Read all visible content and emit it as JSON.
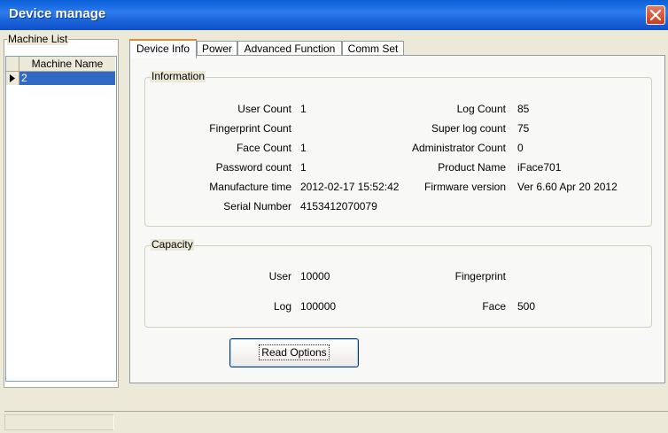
{
  "window": {
    "title": "Device manage"
  },
  "machine_list": {
    "title": "Machine List",
    "column_header": "Machine Name",
    "rows": [
      "2"
    ]
  },
  "tabs": [
    "Device Info",
    "Power",
    "Advanced Function",
    "Comm Set"
  ],
  "information": {
    "title": "Information",
    "left": [
      {
        "label": "User Count",
        "value": "1"
      },
      {
        "label": "Fingerprint Count",
        "value": ""
      },
      {
        "label": "Face Count",
        "value": "1"
      },
      {
        "label": "Password count",
        "value": "1"
      },
      {
        "label": "Manufacture time",
        "value": "2012-02-17 15:52:42"
      },
      {
        "label": "Serial Number",
        "value": "4153412070079"
      }
    ],
    "right": [
      {
        "label": "Log Count",
        "value": "85"
      },
      {
        "label": "Super log count",
        "value": "75"
      },
      {
        "label": "Administrator Count",
        "value": "0"
      },
      {
        "label": "Product Name",
        "value": "iFace701"
      },
      {
        "label": "Firmware version",
        "value": "Ver 6.60 Apr 20 2012"
      }
    ]
  },
  "capacity": {
    "title": "Capacity",
    "left": [
      {
        "label": "User",
        "value": "10000"
      },
      {
        "label": "Log",
        "value": "100000"
      }
    ],
    "right": [
      {
        "label": "Fingerprint",
        "value": ""
      },
      {
        "label": "Face",
        "value": "500"
      }
    ]
  },
  "read_button": "Read Options",
  "icons": {
    "close": "close-icon",
    "row_pointer": "row-pointer-icon"
  },
  "colors": {
    "title_bar": "#0a5fd8",
    "selection": "#316ac5",
    "active_tab_accent": "#e68b2c"
  }
}
